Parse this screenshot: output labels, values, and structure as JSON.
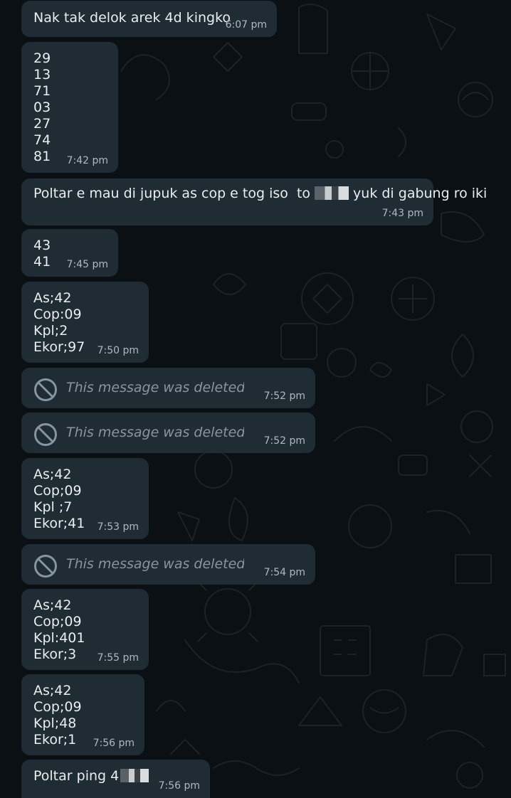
{
  "messages": [
    {
      "type": "text",
      "text": "Nak tak delok arek 4d kingko",
      "time": "6:07 pm"
    },
    {
      "type": "text",
      "text": "29\n13\n71\n03\n27\n74\n81",
      "time": "7:42 pm"
    },
    {
      "type": "text",
      "text_before": "Poltar e mau di jupuk as cop e tog iso  to",
      "text_after": "yuk di gabung ro iki",
      "time": "7:43 pm"
    },
    {
      "type": "text",
      "text": "43\n41",
      "time": "7:45 pm"
    },
    {
      "type": "text",
      "text": "As;42\nCop:09\nKpl;2\nEkor;97",
      "time": "7:50 pm"
    },
    {
      "type": "deleted",
      "text": "This message was deleted",
      "time": "7:52 pm"
    },
    {
      "type": "deleted",
      "text": "This message was deleted",
      "time": "7:52 pm"
    },
    {
      "type": "text",
      "text": "As;42\nCop;09\nKpl ;7\nEkor;41",
      "time": "7:53 pm"
    },
    {
      "type": "deleted",
      "text": "This message was deleted",
      "time": "7:54 pm"
    },
    {
      "type": "text",
      "text": "As;42\nCop;09\nKpl:401\nEkor;3",
      "time": "7:55 pm"
    },
    {
      "type": "text",
      "text": "As;42\nCop;09\nKpl;48\nEkor;1",
      "time": "7:56 pm"
    },
    {
      "type": "text",
      "text_before": "Poltar ping 4",
      "time": "7:56 pm"
    }
  ],
  "theme": {
    "background": "#0b1014",
    "bubble": "#202c33",
    "text": "#e9edef",
    "meta": "#aebac1",
    "deleted": "#8696a0"
  },
  "icons": {
    "deleted": "deleted-ban-icon",
    "wallpaper": "doodle-pattern"
  }
}
